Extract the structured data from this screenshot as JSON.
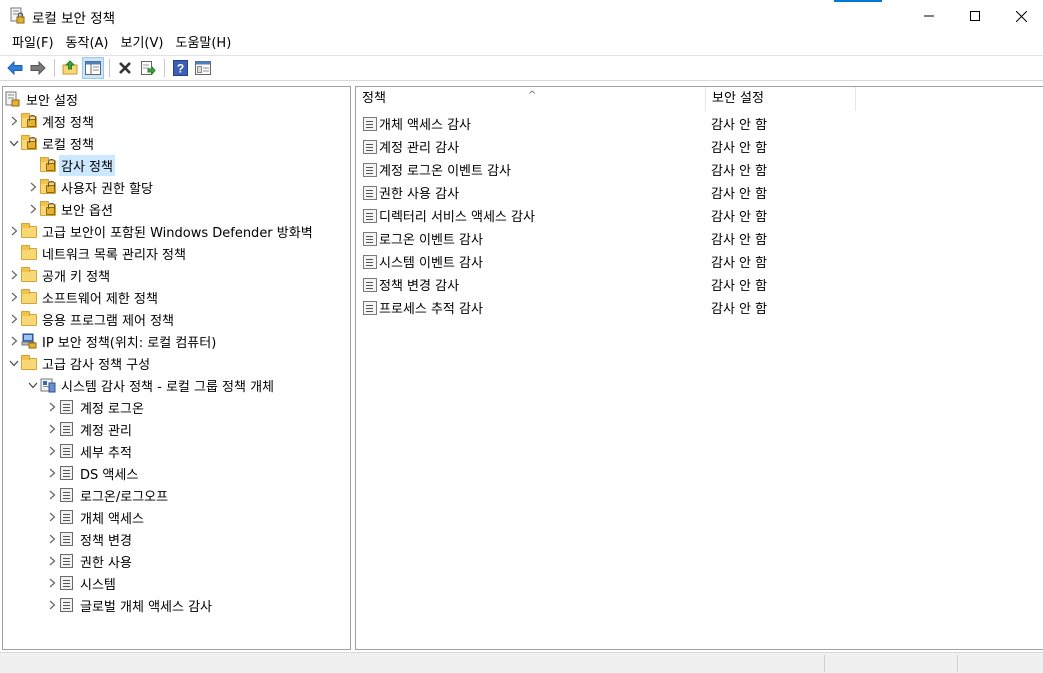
{
  "window": {
    "title": "로컬 보안 정책",
    "icon": "security-policy-icon"
  },
  "menu": [
    "파일(F)",
    "동작(A)",
    "보기(V)",
    "도움말(H)"
  ],
  "toolbar": [
    "back-arrow-icon",
    "forward-arrow-icon",
    "up-folder-icon",
    "show-hide-tree-icon",
    "delete-icon",
    "export-list-icon",
    "help-icon",
    "properties-icon"
  ],
  "tree": {
    "root": "보안 설정",
    "items": [
      {
        "label": "계정 정책",
        "icon": "folder-lock-icon",
        "expander": "collapsed"
      },
      {
        "label": "로컬 정책",
        "icon": "folder-lock-icon",
        "expander": "expanded"
      },
      {
        "label": "감사 정책",
        "icon": "folder-lock-icon",
        "expander": "none",
        "selected": true
      },
      {
        "label": "사용자 권한 할당",
        "icon": "folder-lock-icon",
        "expander": "collapsed"
      },
      {
        "label": "보안 옵션",
        "icon": "folder-lock-icon",
        "expander": "collapsed"
      },
      {
        "label": "고급 보안이 포함된 Windows Defender 방화벽",
        "icon": "folder-icon",
        "expander": "collapsed"
      },
      {
        "label": "네트워크 목록 관리자 정책",
        "icon": "folder-icon",
        "expander": "none"
      },
      {
        "label": "공개 키 정책",
        "icon": "folder-icon",
        "expander": "collapsed"
      },
      {
        "label": "소프트웨어 제한 정책",
        "icon": "folder-icon",
        "expander": "collapsed"
      },
      {
        "label": "응용 프로그램 제어 정책",
        "icon": "folder-icon",
        "expander": "collapsed"
      },
      {
        "label": "IP 보안 정책(위치: 로컬 컴퓨터)",
        "icon": "ip-security-icon",
        "expander": "collapsed"
      },
      {
        "label": "고급 감사 정책 구성",
        "icon": "folder-icon",
        "expander": "expanded"
      },
      {
        "label": "시스템 감사 정책 - 로컬 그룹 정책 개체",
        "icon": "group-policy-icon",
        "expander": "expanded"
      },
      {
        "label": "계정 로그온",
        "icon": "audit-icon",
        "expander": "collapsed"
      },
      {
        "label": "계정 관리",
        "icon": "audit-icon",
        "expander": "collapsed"
      },
      {
        "label": "세부 추적",
        "icon": "audit-icon",
        "expander": "collapsed"
      },
      {
        "label": "DS 액세스",
        "icon": "audit-icon",
        "expander": "collapsed"
      },
      {
        "label": "로그온/로그오프",
        "icon": "audit-icon",
        "expander": "collapsed"
      },
      {
        "label": "개체 액세스",
        "icon": "audit-icon",
        "expander": "collapsed"
      },
      {
        "label": "정책 변경",
        "icon": "audit-icon",
        "expander": "collapsed"
      },
      {
        "label": "권한 사용",
        "icon": "audit-icon",
        "expander": "collapsed"
      },
      {
        "label": "시스템",
        "icon": "audit-icon",
        "expander": "collapsed"
      },
      {
        "label": "글로벌 개체 액세스 감사",
        "icon": "audit-icon",
        "expander": "collapsed"
      }
    ]
  },
  "list": {
    "columns": [
      "정책",
      "보안 설정"
    ],
    "rows": [
      {
        "name": "개체 액세스 감사",
        "setting": "감사 안 함"
      },
      {
        "name": "계정 관리 감사",
        "setting": "감사 안 함"
      },
      {
        "name": "계정 로그온 이벤트 감사",
        "setting": "감사 안 함"
      },
      {
        "name": "권한 사용 감사",
        "setting": "감사 안 함"
      },
      {
        "name": "디렉터리 서비스 액세스 감사",
        "setting": "감사 안 함"
      },
      {
        "name": "로그온 이벤트 감사",
        "setting": "감사 안 함"
      },
      {
        "name": "시스템 이벤트 감사",
        "setting": "감사 안 함"
      },
      {
        "name": "정책 변경 감사",
        "setting": "감사 안 함"
      },
      {
        "name": "프로세스 추적 감사",
        "setting": "감사 안 함"
      }
    ]
  }
}
